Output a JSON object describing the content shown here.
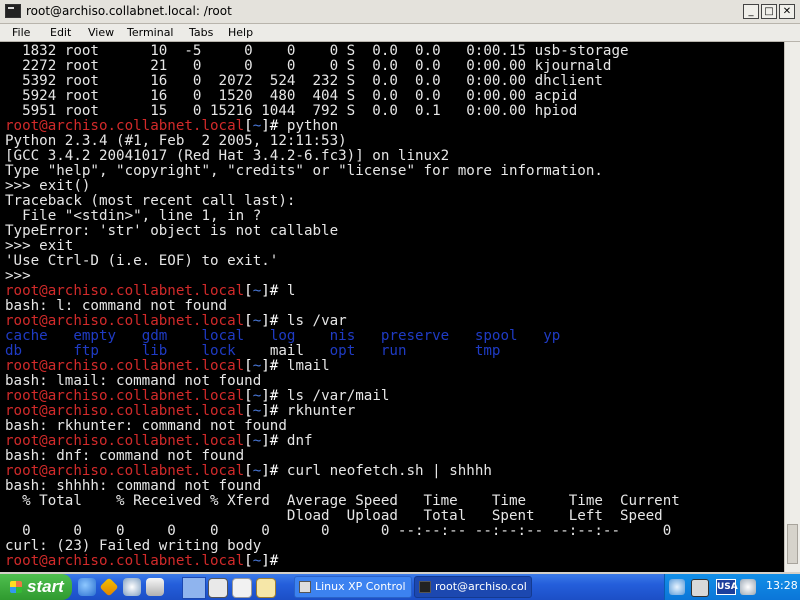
{
  "window": {
    "title": "root@archiso.collabnet.local: /root",
    "menu": [
      "File",
      "Edit",
      "View",
      "Terminal",
      "Tabs",
      "Help"
    ]
  },
  "prompt": {
    "host": "root@archiso.collabnet.local",
    "dir": "~",
    "hash": "#"
  },
  "terminal": {
    "lines": [
      {
        "type": "out",
        "text": "  1832 root      10  -5     0    0    0 S  0.0  0.0   0:00.15 usb-storage"
      },
      {
        "type": "out",
        "text": "  2272 root      21   0     0    0    0 S  0.0  0.0   0:00.00 kjournald"
      },
      {
        "type": "out",
        "text": "  5392 root      16   0  2072  524  232 S  0.0  0.0   0:00.00 dhclient"
      },
      {
        "type": "out",
        "text": "  5924 root      16   0  1520  480  404 S  0.0  0.0   0:00.00 acpid"
      },
      {
        "type": "out",
        "text": "  5951 root      15   0 15216 1044  792 S  0.0  0.1   0:00.00 hpiod"
      },
      {
        "type": "prompt",
        "cmd": " python"
      },
      {
        "type": "out",
        "text": "Python 2.3.4 (#1, Feb  2 2005, 12:11:53)"
      },
      {
        "type": "out",
        "text": "[GCC 3.4.2 20041017 (Red Hat 3.4.2-6.fc3)] on linux2"
      },
      {
        "type": "out",
        "text": "Type \"help\", \"copyright\", \"credits\" or \"license\" for more information."
      },
      {
        "type": "out",
        "text": ">>> exit()"
      },
      {
        "type": "out",
        "text": "Traceback (most recent call last):"
      },
      {
        "type": "out",
        "text": "  File \"<stdin>\", line 1, in ?"
      },
      {
        "type": "out",
        "text": "TypeError: 'str' object is not callable"
      },
      {
        "type": "out",
        "text": ">>> exit"
      },
      {
        "type": "out",
        "text": "'Use Ctrl-D (i.e. EOF) to exit.'"
      },
      {
        "type": "out",
        "text": ">>>"
      },
      {
        "type": "prompt",
        "cmd": " l"
      },
      {
        "type": "out",
        "text": "bash: l: command not found"
      },
      {
        "type": "prompt",
        "cmd": " ls /var"
      },
      {
        "type": "ls",
        "parts": [
          {
            "t": "cache",
            "c": "dir"
          },
          {
            "t": "   "
          },
          {
            "t": "empty",
            "c": "dir"
          },
          {
            "t": "   "
          },
          {
            "t": "gdm",
            "c": "dir"
          },
          {
            "t": "    "
          },
          {
            "t": "local",
            "c": "dir"
          },
          {
            "t": "   "
          },
          {
            "t": "log",
            "c": "dir"
          },
          {
            "t": "    "
          },
          {
            "t": "nis",
            "c": "dir"
          },
          {
            "t": "   "
          },
          {
            "t": "preserve",
            "c": "dir"
          },
          {
            "t": "   "
          },
          {
            "t": "spool",
            "c": "dir"
          },
          {
            "t": "   "
          },
          {
            "t": "yp",
            "c": "dir"
          }
        ]
      },
      {
        "type": "ls",
        "parts": [
          {
            "t": "db",
            "c": "dir"
          },
          {
            "t": "      "
          },
          {
            "t": "ftp",
            "c": "dir"
          },
          {
            "t": "     "
          },
          {
            "t": "lib",
            "c": "dir"
          },
          {
            "t": "    "
          },
          {
            "t": "lock",
            "c": "dir"
          },
          {
            "t": "    "
          },
          {
            "t": "mail",
            "c": "file"
          },
          {
            "t": "   "
          },
          {
            "t": "opt",
            "c": "dir"
          },
          {
            "t": "   "
          },
          {
            "t": "run",
            "c": "dir"
          },
          {
            "t": "        "
          },
          {
            "t": "tmp",
            "c": "dir"
          }
        ]
      },
      {
        "type": "prompt",
        "cmd": " lmail"
      },
      {
        "type": "out",
        "text": "bash: lmail: command not found"
      },
      {
        "type": "prompt",
        "cmd": " ls /var/mail"
      },
      {
        "type": "prompt",
        "cmd": " rkhunter"
      },
      {
        "type": "out",
        "text": "bash: rkhunter: command not found"
      },
      {
        "type": "prompt",
        "cmd": " dnf"
      },
      {
        "type": "out",
        "text": "bash: dnf: command not found"
      },
      {
        "type": "prompt",
        "cmd": " curl neofetch.sh | shhhh"
      },
      {
        "type": "out",
        "text": "bash: shhhh: command not found"
      },
      {
        "type": "out",
        "text": "  % Total    % Received % Xferd  Average Speed   Time    Time     Time  Current"
      },
      {
        "type": "out",
        "text": "                                 Dload  Upload   Total   Spent    Left  Speed"
      },
      {
        "type": "out",
        "text": "  0     0    0     0    0     0      0      0 --:--:-- --:--:-- --:--:--     0"
      },
      {
        "type": "out",
        "text": "curl: (23) Failed writing body"
      },
      {
        "type": "prompt",
        "cmd": ""
      }
    ]
  },
  "taskbar": {
    "start_label": "start",
    "buttons": [
      {
        "label": "Linux XP Control",
        "active": false
      },
      {
        "label": "root@archiso.col",
        "active": true
      }
    ],
    "language": "USA",
    "clock": "13:28"
  },
  "colors": {
    "prompt_host": "#d22a2a",
    "prompt_dir": "#4a78d8",
    "directory": "#1f3bc4",
    "terminal_bg": "#000000",
    "terminal_fg": "#e6e6e6"
  }
}
